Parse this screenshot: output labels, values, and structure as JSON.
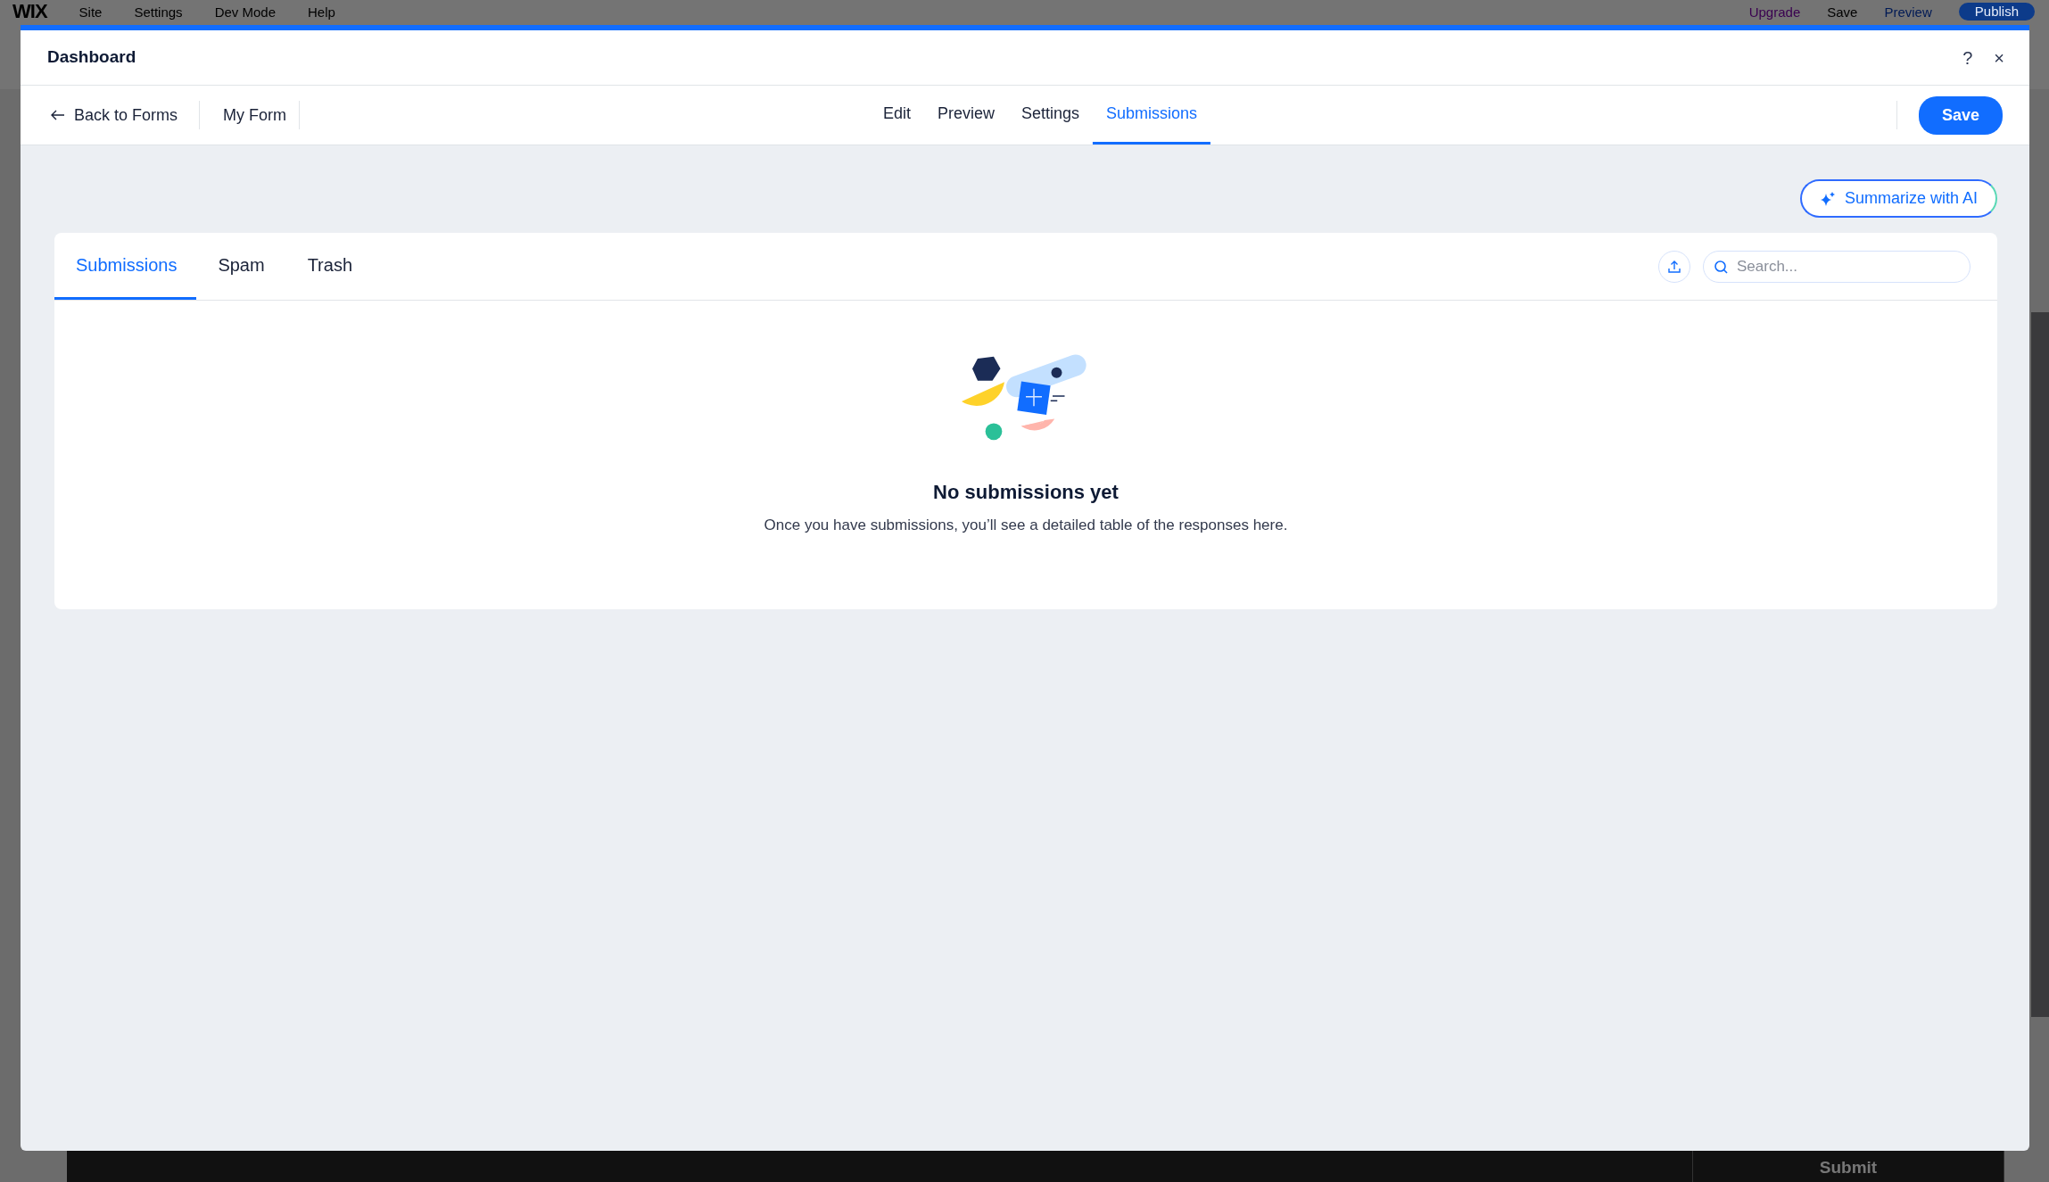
{
  "editor": {
    "logo": "WIX",
    "menu": [
      "Site",
      "Settings",
      "Dev Mode",
      "Help"
    ],
    "actions": [
      {
        "label": "Upgrade",
        "kind": "upgrade"
      },
      {
        "label": "Save",
        "kind": "link"
      },
      {
        "label": "Preview",
        "kind": "preview"
      },
      {
        "label": "Publish",
        "kind": "primary"
      }
    ],
    "footer_button": "Submit"
  },
  "dialog": {
    "title": "Dashboard",
    "help": "?",
    "close": "×"
  },
  "form_nav": {
    "back": "Back to Forms",
    "form_name": "My Form",
    "tabs": [
      {
        "label": "Edit",
        "selected": false
      },
      {
        "label": "Preview",
        "selected": false
      },
      {
        "label": "Settings",
        "selected": false
      },
      {
        "label": "Submissions",
        "selected": true
      }
    ],
    "save": "Save"
  },
  "summarize_button": "Summarize with AI",
  "submissions": {
    "tabs": [
      {
        "label": "Submissions",
        "selected": true
      },
      {
        "label": "Spam",
        "selected": false
      },
      {
        "label": "Trash",
        "selected": false
      }
    ],
    "search": {
      "placeholder": "Search..."
    },
    "empty_state": {
      "title": "No submissions yet",
      "message": "Once you have submissions, you’ll see a detailed table of the responses here."
    }
  }
}
